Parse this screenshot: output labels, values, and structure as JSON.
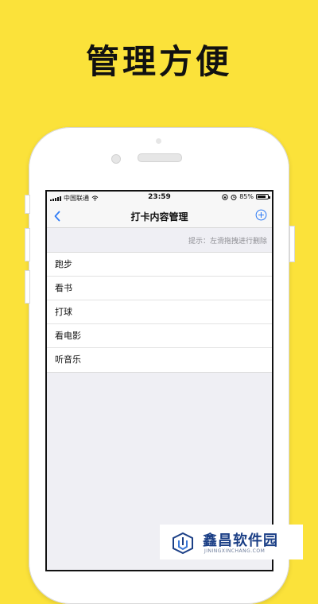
{
  "headline": "管理方便",
  "status_bar": {
    "carrier": "中国联通",
    "time": "23:59",
    "battery": "85%",
    "battery_level": 0.85
  },
  "nav": {
    "back_icon": "chevron-left-icon",
    "title": "打卡内容管理",
    "add_icon": "plus-circle-icon"
  },
  "hint": "提示：左滑拖拽进行删除",
  "items": [
    {
      "label": "跑步"
    },
    {
      "label": "看书"
    },
    {
      "label": "打球"
    },
    {
      "label": "看电影"
    },
    {
      "label": "听音乐"
    }
  ],
  "watermark": {
    "name": "鑫昌软件园",
    "url": "JININGXINCHANG.COM"
  },
  "colors": {
    "background": "#fbe23a",
    "accent": "#2f7cf6",
    "list_bg": "#efeff4"
  }
}
